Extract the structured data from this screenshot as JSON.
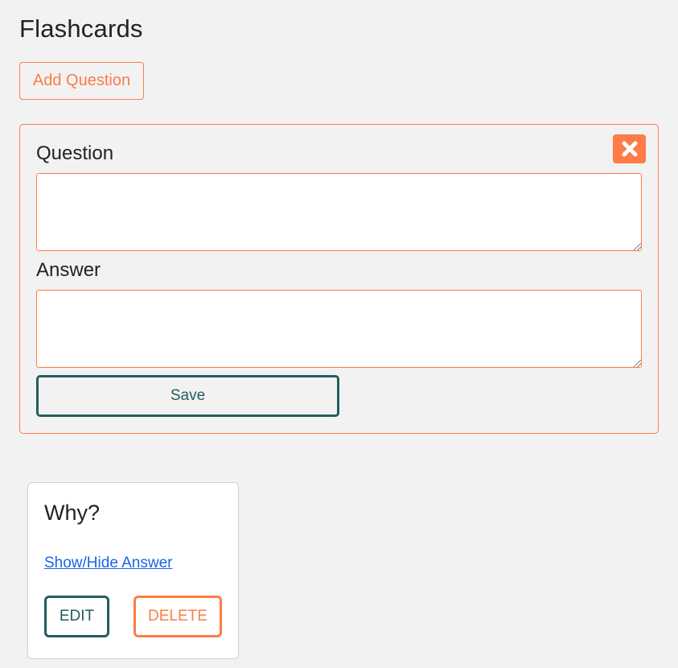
{
  "page": {
    "title": "Flashcards"
  },
  "toolbar": {
    "add_question_label": "Add Question"
  },
  "form": {
    "question_label": "Question",
    "question_value": "",
    "answer_label": "Answer",
    "answer_value": "",
    "save_label": "Save",
    "close_icon": "close-icon"
  },
  "cards": [
    {
      "question": "Why?",
      "toggle_label": "Show/Hide Answer",
      "edit_label": "EDIT",
      "delete_label": "DELETE"
    }
  ],
  "colors": {
    "accent": "#fd7c47",
    "primary": "#225e5e",
    "link": "#1a64e8",
    "background": "#f2f2f2"
  }
}
